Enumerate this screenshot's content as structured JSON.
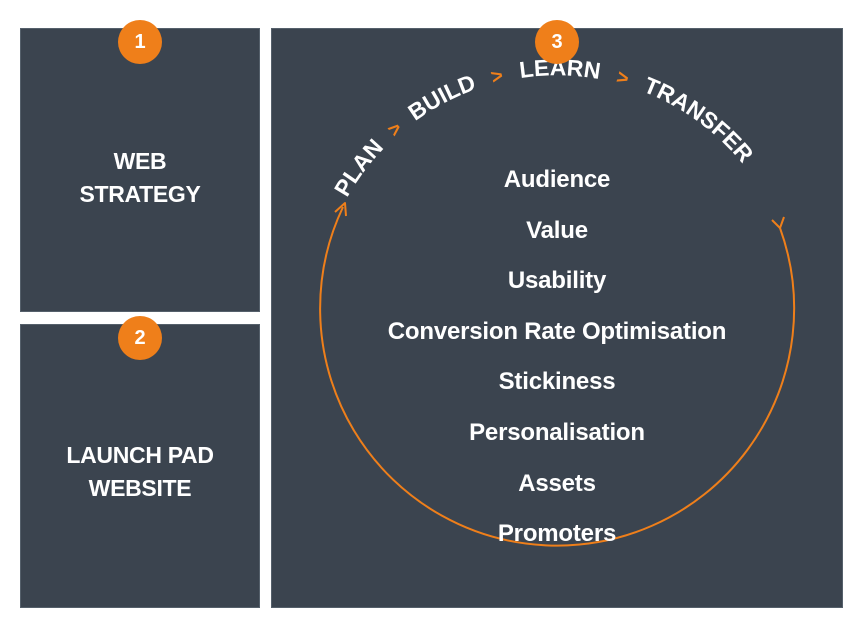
{
  "colors": {
    "panel_background": "#3b444f",
    "accent": "#ef7f1a",
    "text": "#ffffff"
  },
  "panels": [
    {
      "number": "1",
      "title_lines": [
        "WEB",
        "STRATEGY"
      ]
    },
    {
      "number": "2",
      "title_lines": [
        "LAUNCH PAD",
        "WEBSITE"
      ]
    },
    {
      "number": "3"
    }
  ],
  "cycle": {
    "steps": [
      "PLAN",
      "BUILD",
      "LEARN",
      "TRANSFER"
    ],
    "separator": ">",
    "pillars": [
      "Audience",
      "Value",
      "Usability",
      "Conversion Rate Optimisation",
      "Stickiness",
      "Personalisation",
      "Assets",
      "Promoters"
    ]
  }
}
